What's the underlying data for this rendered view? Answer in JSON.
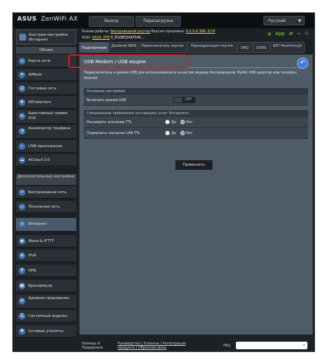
{
  "header": {
    "brand": "ASUS",
    "model": "ZenWiFi AX",
    "logout_label": "Выход",
    "reboot_label": "Перезагрузка",
    "language": "Русский"
  },
  "status": {
    "mode_label": "Режим работы:",
    "mode_value": "Беспроводной роутер",
    "fw_label": "Версия прошивки:",
    "fw_value": "9.0.0.4.386_3/74",
    "ssid_label": "SSID:",
    "ssid_value_1": "ASUS_XT8",
    "ssid_value_2": "6_E1DE02A1F54C...",
    "app_label": "App"
  },
  "sidebar": {
    "quick_setup": "Быстрая настройка Интернет",
    "general_head": "Общие",
    "general_items": [
      {
        "label": "Карта сети",
        "icon": "network-map-icon"
      },
      {
        "label": "AiMesh",
        "icon": "aimesh-icon"
      },
      {
        "label": "Гостевая сеть",
        "icon": "guest-network-icon"
      },
      {
        "label": "AiProtection",
        "icon": "aiprotection-icon"
      },
      {
        "label": "Адаптивный сервис QoS",
        "icon": "qos-icon"
      },
      {
        "label": "Анализатор трафика",
        "icon": "traffic-analyzer-icon"
      },
      {
        "label": "USB-приложение",
        "icon": "usb-app-icon"
      },
      {
        "label": "AiCloud 2.0",
        "icon": "aicloud-icon"
      }
    ],
    "advanced_head": "Дополнительные настройки",
    "advanced_items": [
      {
        "label": "Беспроводная сеть",
        "icon": "wireless-icon"
      },
      {
        "label": "Локальная сеть",
        "icon": "lan-icon"
      },
      {
        "label": "Интернет",
        "icon": "internet-icon"
      },
      {
        "label": "Alexa & IFTTT",
        "icon": "alexa-icon"
      },
      {
        "label": "IPv6",
        "icon": "ipv6-icon"
      },
      {
        "label": "VPN",
        "icon": "vpn-icon"
      },
      {
        "label": "Брандмауэр",
        "icon": "firewall-icon"
      },
      {
        "label": "Администрирование",
        "icon": "administration-icon"
      },
      {
        "label": "Системный журнал",
        "icon": "system-log-icon"
      },
      {
        "label": "Сетевые утилиты",
        "icon": "network-tools-icon"
      }
    ]
  },
  "tabs": [
    "Подключение",
    "Двойной WAN",
    "Переключатель портов",
    "Переадресация портов",
    "DMZ",
    "DDNS",
    "NAT Passthrough"
  ],
  "panel": {
    "title": "USB Modem / USB модем",
    "description": "Переключитесь в режим USB для использования в качестве модема беспроводной 3G/4G USB адаптер или телефон Android.",
    "section_basic": "Основные настройки",
    "usb_mode_label": "Включить режим USB",
    "usb_mode_state": "OFF",
    "section_isp": "Специальные требования поставщика услуг Интернета",
    "extend_ttl_label": "Расширить значение TTL",
    "spoof_ttl_label": "Подменить значение LAN TTL",
    "yes_label": "Да",
    "no_label": "Нет",
    "apply_label": "Применить"
  },
  "footer": {
    "help_1": "Помощь &",
    "help_2": "Поддержка",
    "links_1": "Руководство | Утилиты | Регистрация",
    "links_2": "продукта | Обратная связь",
    "faq": "FAQ"
  }
}
